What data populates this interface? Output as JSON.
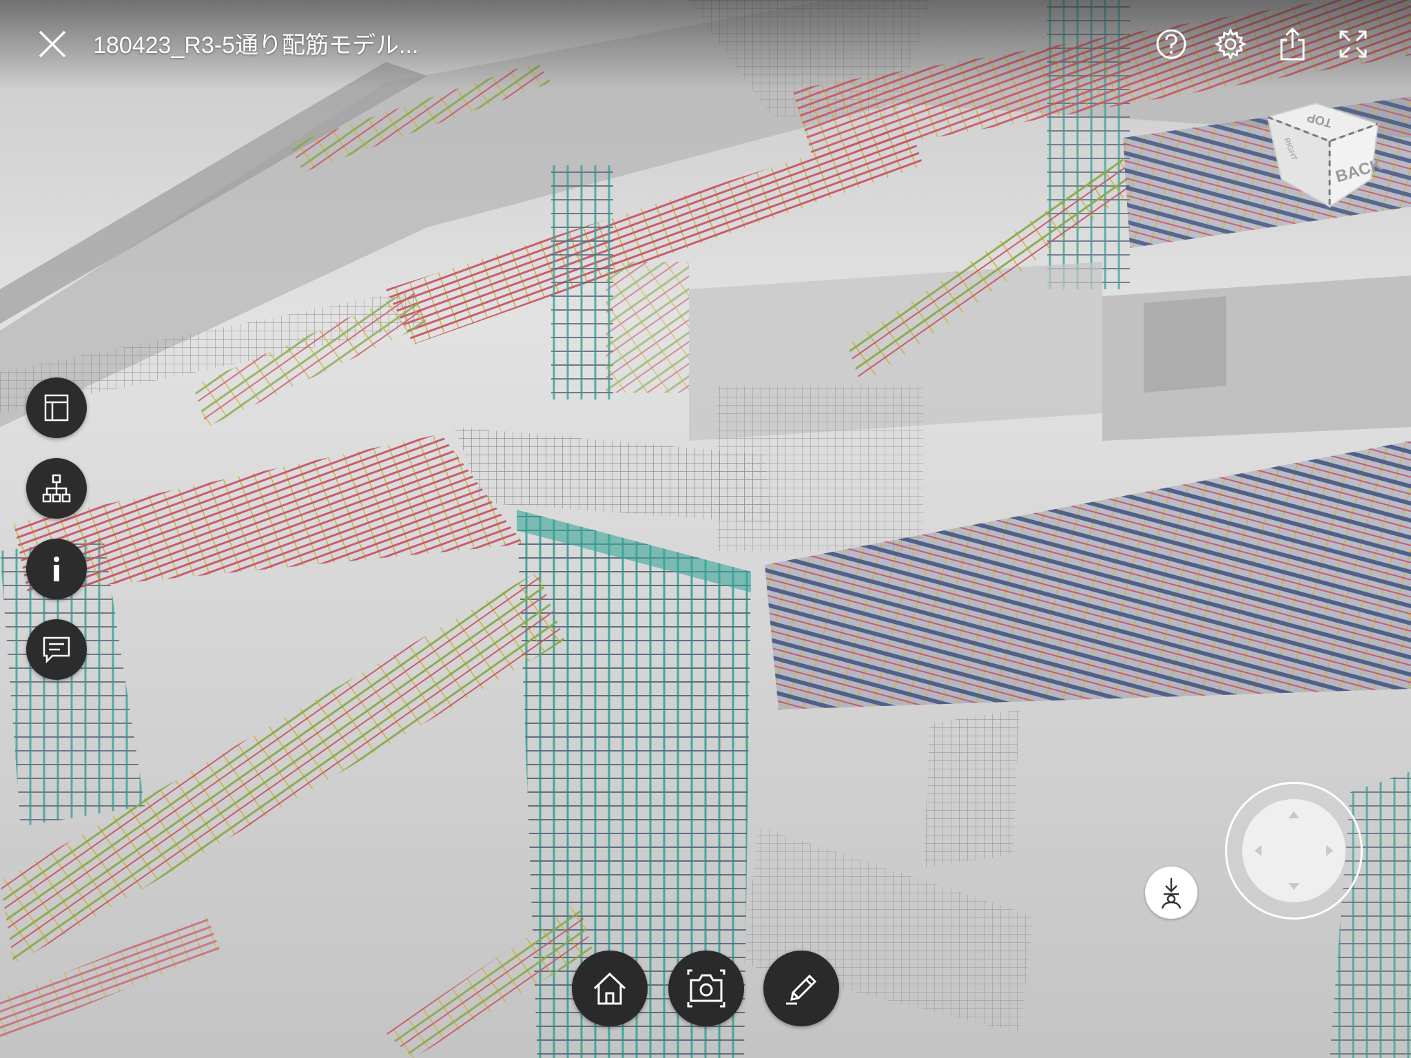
{
  "header": {
    "title": "180423_R3-5通り配筋モデル..."
  },
  "icons": {
    "close": "close-icon",
    "help": "help-icon",
    "settings": "gear-icon",
    "share": "share-icon",
    "fullscreen": "fullscreen-icon"
  },
  "sidebar": {
    "items": [
      {
        "icon": "sheets-icon"
      },
      {
        "icon": "model-tree-icon"
      },
      {
        "icon": "info-icon"
      },
      {
        "icon": "comments-icon"
      }
    ]
  },
  "toolbar": {
    "items": [
      {
        "icon": "home-icon"
      },
      {
        "icon": "camera-icon"
      },
      {
        "icon": "markup-pencil-icon"
      }
    ]
  },
  "viewcube": {
    "top_label": "TOP",
    "back_label": "BACK",
    "side_label": "RIGHT"
  },
  "colors": {
    "rebar_red": "#c8546a",
    "rebar_yellow": "#cdb02f",
    "rebar_teal": "#3aa69a",
    "rebar_green": "#8aa84c",
    "pipe_blue": "#4a5a86",
    "concrete": "#a9a9a9"
  }
}
